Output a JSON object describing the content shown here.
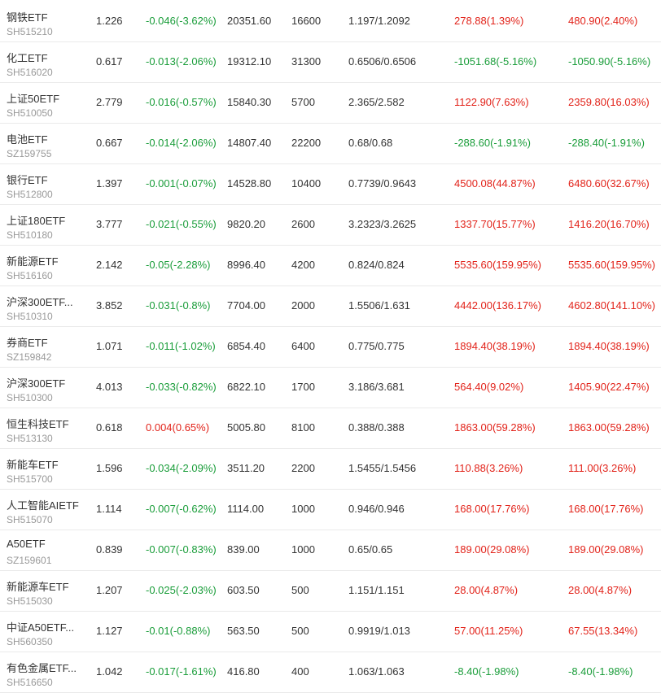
{
  "colors": {
    "up": "#e2231a",
    "down": "#1a9d3a",
    "text": "#333333",
    "subtext": "#999999",
    "divider": "#eaeaea"
  },
  "rows": [
    {
      "name": "钢铁ETF",
      "code": "SH515210",
      "price": "1.226",
      "change": "-0.046(-3.62%)",
      "change_dir": "down",
      "market_value": "20351.60",
      "quantity": "16600",
      "cost": "1.197/1.2092",
      "pnl1": "278.88(1.39%)",
      "pnl1_dir": "up",
      "pnl2": "480.90(2.40%)",
      "pnl2_dir": "up"
    },
    {
      "name": "化工ETF",
      "code": "SH516020",
      "price": "0.617",
      "change": "-0.013(-2.06%)",
      "change_dir": "down",
      "market_value": "19312.10",
      "quantity": "31300",
      "cost": "0.6506/0.6506",
      "pnl1": "-1051.68(-5.16%)",
      "pnl1_dir": "down",
      "pnl2": "-1050.90(-5.16%)",
      "pnl2_dir": "down"
    },
    {
      "name": "上证50ETF",
      "code": "SH510050",
      "price": "2.779",
      "change": "-0.016(-0.57%)",
      "change_dir": "down",
      "market_value": "15840.30",
      "quantity": "5700",
      "cost": "2.365/2.582",
      "pnl1": "1122.90(7.63%)",
      "pnl1_dir": "up",
      "pnl2": "2359.80(16.03%)",
      "pnl2_dir": "up"
    },
    {
      "name": "电池ETF",
      "code": "SZ159755",
      "price": "0.667",
      "change": "-0.014(-2.06%)",
      "change_dir": "down",
      "market_value": "14807.40",
      "quantity": "22200",
      "cost": "0.68/0.68",
      "pnl1": "-288.60(-1.91%)",
      "pnl1_dir": "down",
      "pnl2": "-288.40(-1.91%)",
      "pnl2_dir": "down"
    },
    {
      "name": "银行ETF",
      "code": "SH512800",
      "price": "1.397",
      "change": "-0.001(-0.07%)",
      "change_dir": "down",
      "market_value": "14528.80",
      "quantity": "10400",
      "cost": "0.7739/0.9643",
      "pnl1": "4500.08(44.87%)",
      "pnl1_dir": "up",
      "pnl2": "6480.60(32.67%)",
      "pnl2_dir": "up"
    },
    {
      "name": "上证180ETF",
      "code": "SH510180",
      "price": "3.777",
      "change": "-0.021(-0.55%)",
      "change_dir": "down",
      "market_value": "9820.20",
      "quantity": "2600",
      "cost": "3.2323/3.2625",
      "pnl1": "1337.70(15.77%)",
      "pnl1_dir": "up",
      "pnl2": "1416.20(16.70%)",
      "pnl2_dir": "up"
    },
    {
      "name": "新能源ETF",
      "code": "SH516160",
      "price": "2.142",
      "change": "-0.05(-2.28%)",
      "change_dir": "down",
      "market_value": "8996.40",
      "quantity": "4200",
      "cost": "0.824/0.824",
      "pnl1": "5535.60(159.95%)",
      "pnl1_dir": "up",
      "pnl2": "5535.60(159.95%)",
      "pnl2_dir": "up"
    },
    {
      "name": "沪深300ETF...",
      "code": "SH510310",
      "price": "3.852",
      "change": "-0.031(-0.8%)",
      "change_dir": "down",
      "market_value": "7704.00",
      "quantity": "2000",
      "cost": "1.5506/1.631",
      "pnl1": "4442.00(136.17%)",
      "pnl1_dir": "up",
      "pnl2": "4602.80(141.10%)",
      "pnl2_dir": "up"
    },
    {
      "name": "券商ETF",
      "code": "SZ159842",
      "price": "1.071",
      "change": "-0.011(-1.02%)",
      "change_dir": "down",
      "market_value": "6854.40",
      "quantity": "6400",
      "cost": "0.775/0.775",
      "pnl1": "1894.40(38.19%)",
      "pnl1_dir": "up",
      "pnl2": "1894.40(38.19%)",
      "pnl2_dir": "up"
    },
    {
      "name": "沪深300ETF",
      "code": "SH510300",
      "price": "4.013",
      "change": "-0.033(-0.82%)",
      "change_dir": "down",
      "market_value": "6822.10",
      "quantity": "1700",
      "cost": "3.186/3.681",
      "pnl1": "564.40(9.02%)",
      "pnl1_dir": "up",
      "pnl2": "1405.90(22.47%)",
      "pnl2_dir": "up"
    },
    {
      "name": "恒生科技ETF",
      "code": "SH513130",
      "price": "0.618",
      "change": "0.004(0.65%)",
      "change_dir": "up",
      "market_value": "5005.80",
      "quantity": "8100",
      "cost": "0.388/0.388",
      "pnl1": "1863.00(59.28%)",
      "pnl1_dir": "up",
      "pnl2": "1863.00(59.28%)",
      "pnl2_dir": "up"
    },
    {
      "name": "新能车ETF",
      "code": "SH515700",
      "price": "1.596",
      "change": "-0.034(-2.09%)",
      "change_dir": "down",
      "market_value": "3511.20",
      "quantity": "2200",
      "cost": "1.5455/1.5456",
      "pnl1": "110.88(3.26%)",
      "pnl1_dir": "up",
      "pnl2": "111.00(3.26%)",
      "pnl2_dir": "up"
    },
    {
      "name": "人工智能AIETF",
      "code": "SH515070",
      "price": "1.114",
      "change": "-0.007(-0.62%)",
      "change_dir": "down",
      "market_value": "1114.00",
      "quantity": "1000",
      "cost": "0.946/0.946",
      "pnl1": "168.00(17.76%)",
      "pnl1_dir": "up",
      "pnl2": "168.00(17.76%)",
      "pnl2_dir": "up"
    },
    {
      "name": "A50ETF",
      "code": "SZ159601",
      "price": "0.839",
      "change": "-0.007(-0.83%)",
      "change_dir": "down",
      "market_value": "839.00",
      "quantity": "1000",
      "cost": "0.65/0.65",
      "pnl1": "189.00(29.08%)",
      "pnl1_dir": "up",
      "pnl2": "189.00(29.08%)",
      "pnl2_dir": "up"
    },
    {
      "name": "新能源车ETF",
      "code": "SH515030",
      "price": "1.207",
      "change": "-0.025(-2.03%)",
      "change_dir": "down",
      "market_value": "603.50",
      "quantity": "500",
      "cost": "1.151/1.151",
      "pnl1": "28.00(4.87%)",
      "pnl1_dir": "up",
      "pnl2": "28.00(4.87%)",
      "pnl2_dir": "up"
    },
    {
      "name": "中证A50ETF...",
      "code": "SH560350",
      "price": "1.127",
      "change": "-0.01(-0.88%)",
      "change_dir": "down",
      "market_value": "563.50",
      "quantity": "500",
      "cost": "0.9919/1.013",
      "pnl1": "57.00(11.25%)",
      "pnl1_dir": "up",
      "pnl2": "67.55(13.34%)",
      "pnl2_dir": "up"
    },
    {
      "name": "有色金属ETF...",
      "code": "SH516650",
      "price": "1.042",
      "change": "-0.017(-1.61%)",
      "change_dir": "down",
      "market_value": "416.80",
      "quantity": "400",
      "cost": "1.063/1.063",
      "pnl1": "-8.40(-1.98%)",
      "pnl1_dir": "down",
      "pnl2": "-8.40(-1.98%)",
      "pnl2_dir": "down"
    }
  ]
}
